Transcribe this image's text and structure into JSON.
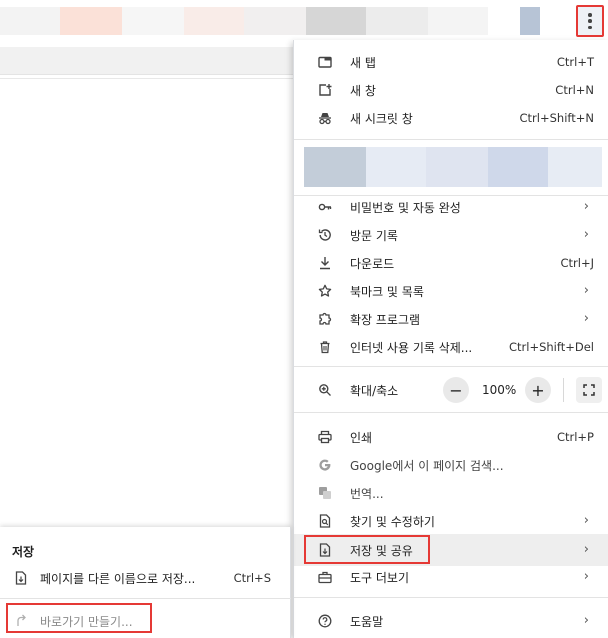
{
  "toolbar": {
    "menu_icon": "more-vert-icon",
    "highlight_color": "#e53935"
  },
  "menu": {
    "new_tab": {
      "label": "새 탭",
      "shortcut": "Ctrl+T",
      "icon": "new-tab-icon"
    },
    "new_window": {
      "label": "새 창",
      "shortcut": "Ctrl+N",
      "icon": "new-window-icon"
    },
    "incognito": {
      "label": "새 시크릿 창",
      "shortcut": "Ctrl+Shift+N",
      "icon": "incognito-icon"
    },
    "passwords": {
      "label": "비밀번호 및 자동 완성",
      "icon": "key-icon"
    },
    "history": {
      "label": "방문 기록",
      "icon": "history-icon"
    },
    "downloads": {
      "label": "다운로드",
      "shortcut": "Ctrl+J",
      "icon": "download-icon"
    },
    "bookmarks": {
      "label": "북마크 및 목록",
      "icon": "star-icon"
    },
    "extensions": {
      "label": "확장 프로그램",
      "icon": "puzzle-icon"
    },
    "clear_data": {
      "label": "인터넷 사용 기록 삭제...",
      "shortcut": "Ctrl+Shift+Del",
      "icon": "trash-icon"
    },
    "zoom": {
      "label": "확대/축소",
      "value": "100%",
      "minus": "−",
      "plus": "+",
      "icon": "zoom-icon"
    },
    "print": {
      "label": "인쇄",
      "shortcut": "Ctrl+P",
      "icon": "print-icon"
    },
    "google_search": {
      "label": "Google에서 이 페이지 검색...",
      "icon": "google-icon"
    },
    "translate": {
      "label": "번역...",
      "icon": "translate-icon"
    },
    "find_edit": {
      "label": "찾기 및 수정하기",
      "icon": "find-icon"
    },
    "save_share": {
      "label": "저장 및 공유",
      "icon": "save-share-icon",
      "highlighted": true
    },
    "more_tools": {
      "label": "도구 더보기",
      "icon": "toolbox-icon"
    },
    "help": {
      "label": "도움말",
      "icon": "help-icon"
    }
  },
  "submenu": {
    "title": "저장",
    "save_as": {
      "label": "페이지를 다른 이름으로 저장...",
      "shortcut": "Ctrl+S",
      "icon": "save-page-icon"
    },
    "create_shortcut": {
      "label": "바로가기 만들기...",
      "icon": "shortcut-icon",
      "disabled": true
    }
  }
}
